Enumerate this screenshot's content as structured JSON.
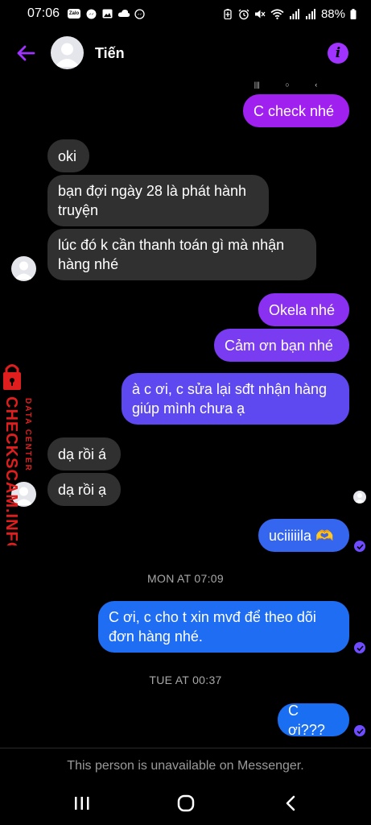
{
  "status_bar": {
    "time": "07:06",
    "battery": "88%",
    "left_icons": [
      "zalo-icon",
      "messenger-icon",
      "gallery-icon",
      "cloud-icon",
      "messenger-icon"
    ],
    "right_icons": [
      "battery-saver-icon",
      "alarm-icon",
      "mute-icon",
      "wifi-icon",
      "signal-icon",
      "signal-icon",
      "battery-icon"
    ]
  },
  "header": {
    "contact_name": "Tiến"
  },
  "messages": [
    {
      "id": "m1",
      "side": "sent",
      "text": "C check nhé"
    },
    {
      "id": "m2",
      "side": "received",
      "text": "oki"
    },
    {
      "id": "m3",
      "side": "received",
      "line1": "bạn đợi ngày 28 là phát hành",
      "line2": "truyện"
    },
    {
      "id": "m4",
      "side": "received",
      "line1": "lúc đó k cần thanh toán gì mà nhận",
      "line2": "hàng nhé"
    },
    {
      "id": "m5",
      "side": "sent",
      "text": "Okela nhé"
    },
    {
      "id": "m6",
      "side": "sent",
      "text": "Cảm ơn bạn nhé"
    },
    {
      "id": "m7",
      "side": "sent",
      "line1": "à c ơi, c sửa lại sđt nhận hàng",
      "line2": "giúp mình chưa ạ"
    },
    {
      "id": "m8",
      "side": "received",
      "text": "dạ rồi á"
    },
    {
      "id": "m9",
      "side": "received",
      "text": "dạ rồi ạ"
    },
    {
      "id": "m10",
      "side": "sent",
      "text": "uciiiiila 🫶"
    },
    {
      "id": "m11",
      "side": "sent",
      "line1": "C ơi, c cho t xin mvđ để theo dõi",
      "line2": "đơn hàng nhé."
    },
    {
      "id": "m12",
      "side": "sent",
      "text": "C ơi???"
    }
  ],
  "timestamps": {
    "t1": "MON AT 07:09",
    "t2": "TUE AT 00:37"
  },
  "watermark": {
    "brand": "CHECKSCAM.INFO",
    "tagline": "DATA CENTER"
  },
  "footer": {
    "unavailable_text": "This person is unavailable on Messenger."
  },
  "colors": {
    "accent_purple": "#a033ff",
    "received_bubble": "#303030",
    "sent_gradient": [
      "#a020f0",
      "#7a3cf0",
      "#5a4cf0",
      "#2f6bf0",
      "#1a6ef2"
    ],
    "watermark_red": "#e01e1e"
  }
}
